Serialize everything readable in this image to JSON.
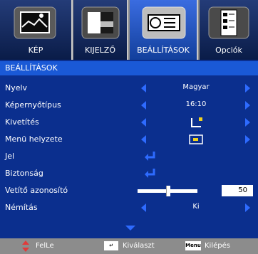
{
  "tabs": [
    {
      "label": "KÉP",
      "icon": "picture-icon"
    },
    {
      "label": "KIJELZŐ",
      "icon": "display-icon"
    },
    {
      "label": "BEÁLLÍTÁSOK",
      "icon": "projector-icon"
    },
    {
      "label": "Opciók",
      "icon": "options-icon"
    }
  ],
  "section_title": "BEÁLLÍTÁSOK",
  "rows": [
    {
      "label": "Nyelv",
      "value": "Magyar"
    },
    {
      "label": "Képernyőtípus",
      "value": "16:10"
    },
    {
      "label": "Kivetítés",
      "value_icon": "projection-mode-icon"
    },
    {
      "label": "Menü helyzete",
      "value_icon": "menu-position-icon"
    },
    {
      "label": "Jel",
      "value_icon": "enter-icon"
    },
    {
      "label": "Biztonság",
      "value_icon": "enter-icon"
    },
    {
      "label": "Vetítő azonosító",
      "value": "50",
      "slider_level": 0.5
    },
    {
      "label": "Némítás",
      "value": "Ki"
    }
  ],
  "footer": {
    "move_label": "FelLe",
    "select_key": "↵",
    "select_label": "Kiválaszt",
    "menu_key": "Menu",
    "exit_label": "Kilépés"
  },
  "colors": {
    "background": "#0b2f8e",
    "section_bar": "#1a59d6",
    "arrow": "#2e6bff",
    "enter_icon": "#2e6bff",
    "move_icon": "#e03a3a",
    "chrome": "#8c8c8c"
  }
}
